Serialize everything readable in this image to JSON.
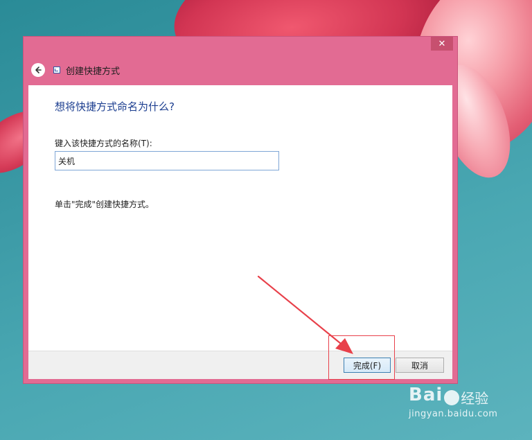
{
  "window": {
    "close_label": "✕",
    "title": "创建快捷方式",
    "back_icon": "arrow-left-icon",
    "accent_color": "#e26b93"
  },
  "content": {
    "heading": "想将快捷方式命名为什么?",
    "name_label": "键入该快捷方式的名称(T):",
    "name_value": "关机",
    "hint": "单击\"完成\"创建快捷方式。"
  },
  "footer": {
    "finish_label": "完成(F)",
    "cancel_label": "取消"
  },
  "watermark": {
    "logo_left": "Bai",
    "logo_right": "经验",
    "url": "jingyan.baidu.com"
  }
}
